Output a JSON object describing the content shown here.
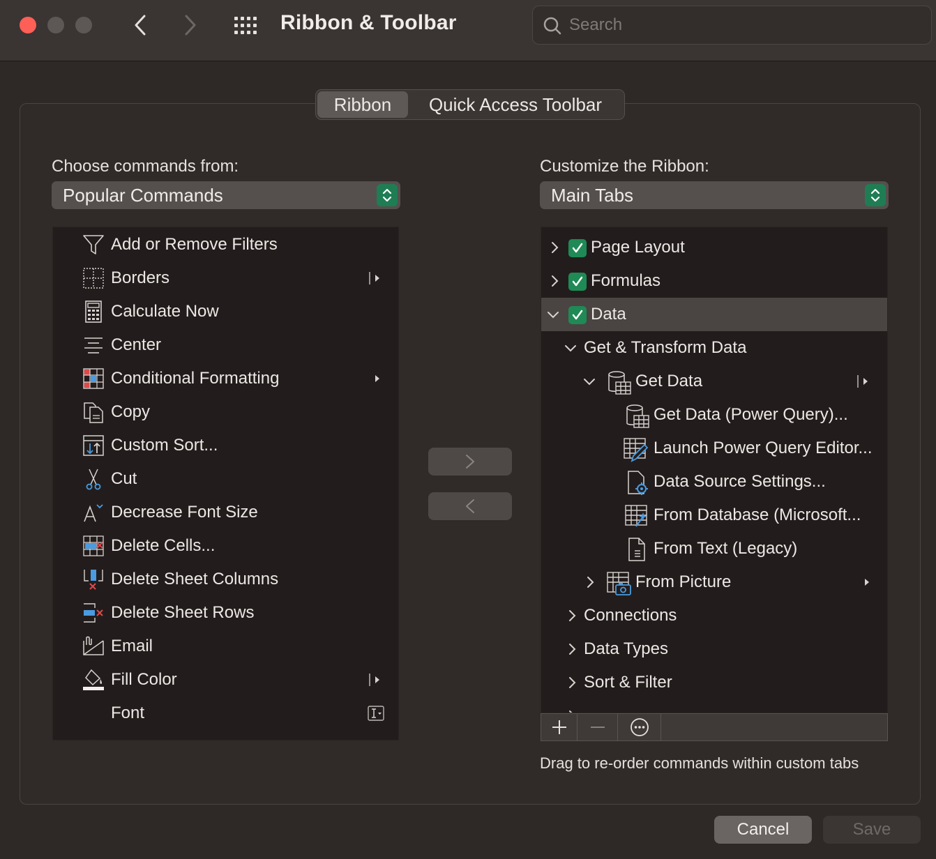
{
  "window": {
    "title": "Ribbon & Toolbar",
    "search_placeholder": "Search"
  },
  "tabs": [
    {
      "label": "Ribbon",
      "selected": true
    },
    {
      "label": "Quick Access Toolbar",
      "selected": false
    }
  ],
  "left": {
    "label": "Choose commands from:",
    "select_value": "Popular Commands",
    "commands": [
      {
        "label": "Add or Remove Filters",
        "icon": "filter-icon",
        "submenu": false
      },
      {
        "label": "Borders",
        "icon": "borders-icon",
        "submenu": "split"
      },
      {
        "label": "Calculate Now",
        "icon": "calculator-icon",
        "submenu": false
      },
      {
        "label": "Center",
        "icon": "align-center-icon",
        "submenu": false
      },
      {
        "label": "Conditional Formatting",
        "icon": "conditional-formatting-icon",
        "submenu": "arrow"
      },
      {
        "label": "Copy",
        "icon": "copy-icon",
        "submenu": false
      },
      {
        "label": "Custom Sort...",
        "icon": "custom-sort-icon",
        "submenu": false
      },
      {
        "label": "Cut",
        "icon": "scissors-icon",
        "submenu": false
      },
      {
        "label": "Decrease Font Size",
        "icon": "decrease-font-icon",
        "submenu": false
      },
      {
        "label": "Delete Cells...",
        "icon": "delete-cells-icon",
        "submenu": false
      },
      {
        "label": "Delete Sheet Columns",
        "icon": "delete-columns-icon",
        "submenu": false
      },
      {
        "label": "Delete Sheet Rows",
        "icon": "delete-rows-icon",
        "submenu": false
      },
      {
        "label": "Email",
        "icon": "email-icon",
        "submenu": false
      },
      {
        "label": "Fill Color",
        "icon": "fill-color-icon",
        "submenu": "split"
      },
      {
        "label": "Font",
        "icon": "",
        "submenu": "font-box"
      }
    ]
  },
  "right": {
    "label": "Customize the Ribbon:",
    "select_value": "Main Tabs",
    "tree": [
      {
        "label": "Page Layout",
        "level": 0,
        "expanded": false,
        "checkbox": true
      },
      {
        "label": "Formulas",
        "level": 0,
        "expanded": false,
        "checkbox": true
      },
      {
        "label": "Data",
        "level": 0,
        "expanded": true,
        "checkbox": true,
        "selected": true
      },
      {
        "label": "Get & Transform Data",
        "level": 1,
        "expanded": true
      },
      {
        "label": "Get Data",
        "level": 2,
        "expanded": true,
        "icon": "database-icon",
        "submenu": "split"
      },
      {
        "label": "Get Data (Power Query)...",
        "level": 3,
        "icon": "database-table-icon"
      },
      {
        "label": "Launch Power Query Editor...",
        "level": 3,
        "icon": "table-edit-icon"
      },
      {
        "label": "Data Source Settings...",
        "level": 3,
        "icon": "settings-doc-icon"
      },
      {
        "label": "From Database (Microsoft...",
        "level": 3,
        "icon": "table-sparkle-icon"
      },
      {
        "label": "From Text (Legacy)",
        "level": 3,
        "icon": "text-doc-icon"
      },
      {
        "label": "From Picture",
        "level": 2,
        "expanded": false,
        "icon": "picture-table-icon",
        "submenu": "arrow"
      },
      {
        "label": "Connections",
        "level": 1,
        "expanded": false
      },
      {
        "label": "Data Types",
        "level": 1,
        "expanded": false
      },
      {
        "label": "Sort & Filter",
        "level": 1,
        "expanded": false
      }
    ],
    "hint": "Drag to re-order commands within custom tabs"
  },
  "buttons": {
    "cancel": "Cancel",
    "save": "Save"
  },
  "colors": {
    "accent_green": "#1f8a55",
    "icon_blue": "#4a9be0",
    "icon_red": "#e0484a",
    "close_red": "#fe5f57"
  }
}
